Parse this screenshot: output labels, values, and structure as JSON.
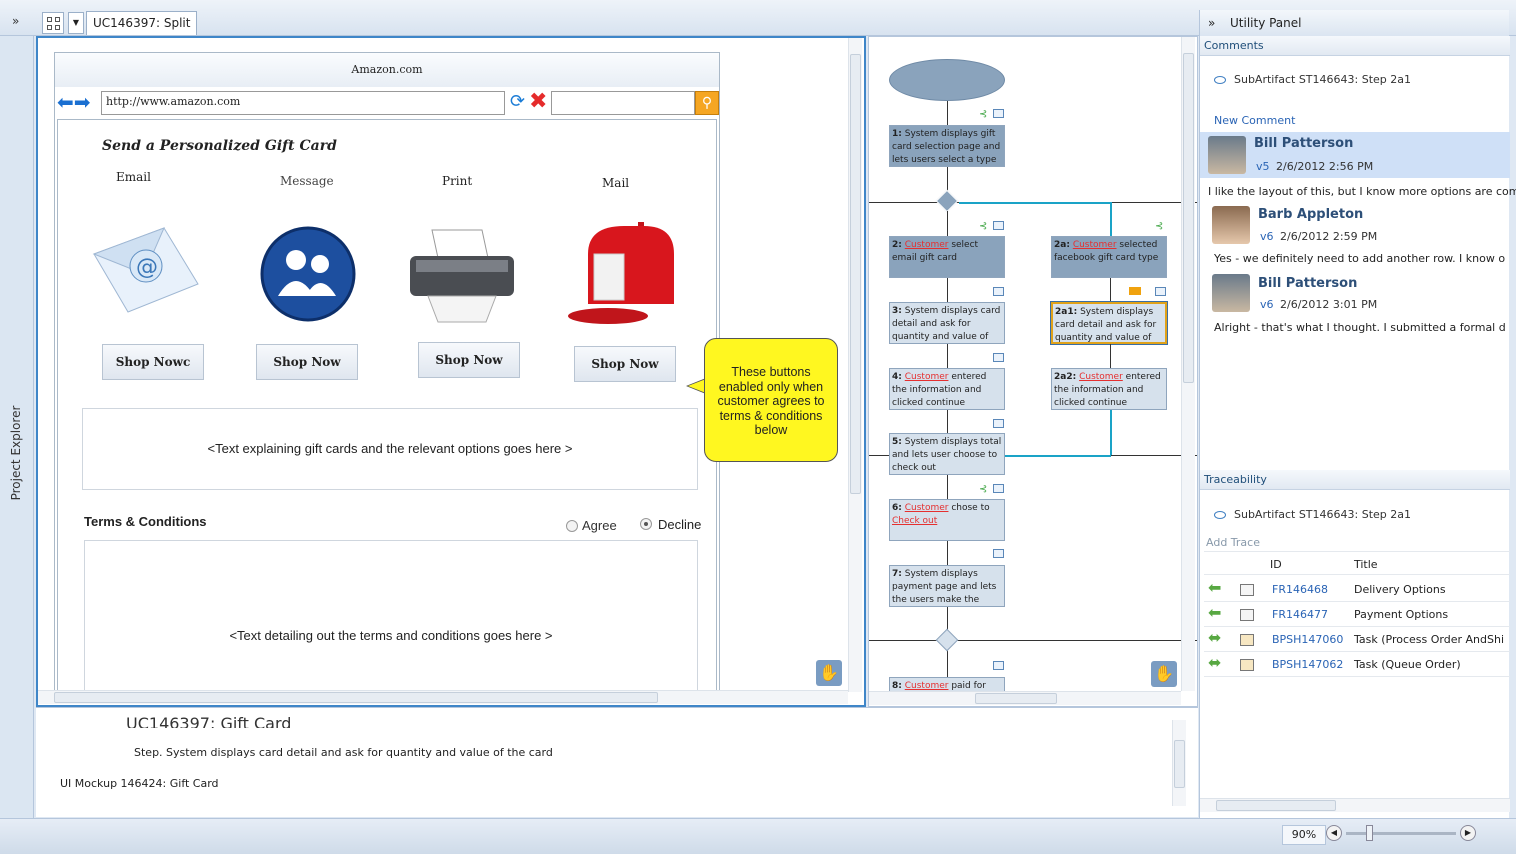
{
  "toolbar": {
    "collapse": "»",
    "tab_title": "UC146397: Split"
  },
  "project_explorer": {
    "label": "Project Explorer"
  },
  "mockup": {
    "browser_title": "Amazon.com",
    "url": "http://www.amazon.com",
    "heading": "Send a Personalized Gift Card",
    "options": [
      {
        "label": "Email",
        "button": "Shop Nowc"
      },
      {
        "label": "Message",
        "button": "Shop Now"
      },
      {
        "label": "Print",
        "button": "Shop Now"
      },
      {
        "label": "Mail",
        "button": "Shop Now"
      }
    ],
    "explain_text": "<Text explaining  gift cards and the relevant options goes here  >",
    "terms_label": "Terms & Conditions",
    "agree": "Agree",
    "decline": "Decline",
    "selected": "Decline",
    "terms_text": "<Text detailing out the terms and conditions goes here >",
    "callout": "These buttons enabled only when customer agrees to terms & conditions below"
  },
  "flow": {
    "steps": {
      "s1_num": "1:",
      "s1_text": "System displays gift card selection page and lets users select a type",
      "s2_num": "2:",
      "s2_cust": "Customer",
      "s2_text": " select email gift card",
      "s2a_num": "2a:",
      "s2a_cust": "Customer",
      "s2a_text": " selected facebook gift card type",
      "s3_num": "3:",
      "s3_text": "System displays card detail and ask for quantity and  value of",
      "s2a1_num": "2a1:",
      "s2a1_text": "System displays card detail and ask for quantity and  value of",
      "s4_num": "4:",
      "s4_cust": "Customer",
      "s4_text": "  entered the information and clicked continue",
      "s2a2_num": "2a2:",
      "s2a2_cust": "Customer",
      "s2a2_text": " entered the information and clicked continue",
      "s5_num": "5:",
      "s5_text": "System displays total and lets user choose to check out",
      "s6_num": "6:",
      "s6_cust": "Customer",
      "s6_text": "  chose to ",
      "s6_link": "Check out",
      "s7_num": "7:",
      "s7_text": "System displays payment page and lets the users make the",
      "s8_num": "8:",
      "s8_cust": "Customer",
      "s8_text": "  paid for"
    }
  },
  "info": {
    "title": "UC146397: Gift Card",
    "step": "Step. System displays card detail and ask for quantity and  value of the card",
    "ui_mockup": "UI Mockup   146424: Gift Card"
  },
  "utility": {
    "collapse": "»",
    "title": "Utility Panel",
    "comments_head": "Comments",
    "subartifact": "SubArtifact ST146643: Step 2a1",
    "new_comment": "New Comment",
    "comments": [
      {
        "name": "Bill Patterson",
        "version": "v5",
        "date": "2/6/2012 2:56 PM",
        "text": "I like the layout of this, but I know more options are com"
      },
      {
        "name": "Barb Appleton",
        "version": "v6",
        "date": "2/6/2012 2:59 PM",
        "text": "Yes - we definitely need to add another row.  I know o"
      },
      {
        "name": "Bill Patterson",
        "version": "v6",
        "date": "2/6/2012 3:01 PM",
        "text": "Alright - that's what I thought.  I submitted a formal d"
      }
    ],
    "trace_head": "Traceability",
    "trace_subartifact": "SubArtifact ST146643: Step 2a1",
    "add_trace": "Add Trace",
    "trace_cols": {
      "id": "ID",
      "title": "Title"
    },
    "traces": [
      {
        "id": "FR146468",
        "title": "Delivery Options"
      },
      {
        "id": "FR146477",
        "title": "Payment Options"
      },
      {
        "id": "BPSH147060",
        "title": "Task (Process Order AndShi"
      },
      {
        "id": "BPSH147062",
        "title": "Task (Queue Order)"
      }
    ]
  },
  "status": {
    "zoom": "90%"
  },
  "colors": {
    "accent": "#3f86c8",
    "callout": "#fff720",
    "customer": "#e53030",
    "link": "#2a64b5"
  }
}
